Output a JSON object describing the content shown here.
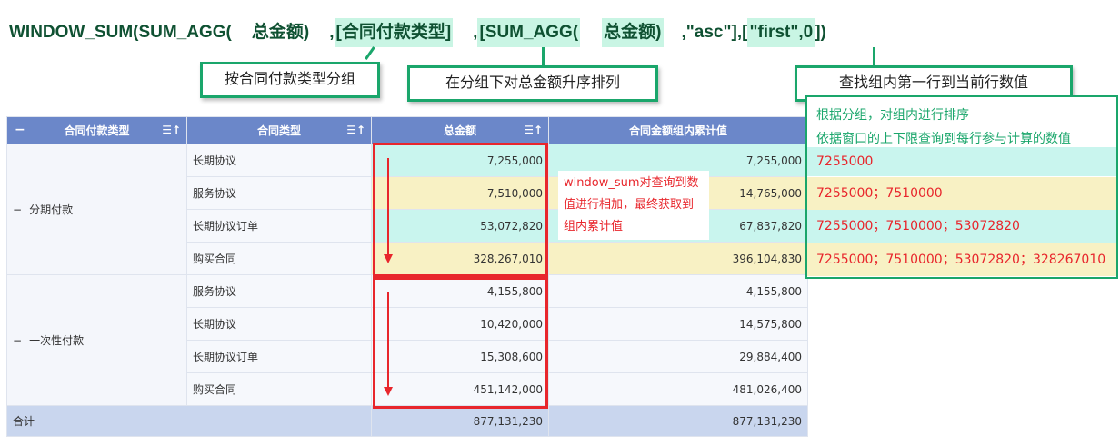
{
  "formula": {
    "p1": "WINDOW_SUM(SUM_AGG(",
    "p2": "总金额)",
    "p3": ",",
    "p4": "[合同付款类型]",
    "p5": ",",
    "p6": "[SUM_AGG(",
    "p7": "总金额)",
    "p8": ",\"asc\"],[",
    "p9": "\"first\",0",
    "p10": "])"
  },
  "labels": {
    "group_by": "按合同付款类型分组",
    "sort": "在分组下对总金额升序排列",
    "find": "查找组内第一行到当前行数值"
  },
  "table": {
    "headers": [
      "合同付款类型",
      "合同类型",
      "总金额",
      "合同金额组内累计值"
    ],
    "groups": [
      {
        "name": "分期付款",
        "rows": [
          {
            "type": "长期协议",
            "amount": "7,255,000",
            "cumulative": "7,255,000"
          },
          {
            "type": "服务协议",
            "amount": "7,510,000",
            "cumulative": "14,765,000"
          },
          {
            "type": "长期协议订单",
            "amount": "53,072,820",
            "cumulative": "67,837,820"
          },
          {
            "type": "购买合同",
            "amount": "328,267,010",
            "cumulative": "396,104,830"
          }
        ]
      },
      {
        "name": "一次性付款",
        "rows": [
          {
            "type": "服务协议",
            "amount": "4,155,800",
            "cumulative": "4,155,800"
          },
          {
            "type": "长期协议",
            "amount": "10,420,000",
            "cumulative": "14,575,800"
          },
          {
            "type": "长期协议订单",
            "amount": "15,308,600",
            "cumulative": "29,884,400"
          },
          {
            "type": "购买合同",
            "amount": "451,142,000",
            "cumulative": "481,026,400"
          }
        ]
      }
    ],
    "total": {
      "label": "合计",
      "amount": "877,131,230",
      "cumulative": "877,131,230"
    }
  },
  "note": "window_sum对查询到数值进行相加，最终获取到组内累计值",
  "side": {
    "line1": "根据分组，对组内进行排序",
    "line2": "依据窗口的上下限查询到每行参与计算的数值",
    "rows": [
      "7255000",
      "7255000；7510000",
      "7255000；7510000；53072820",
      "7255000；7510000；53072820；328267010"
    ]
  },
  "colors": {
    "accent_green": "#1aa66b",
    "red": "#e8262c",
    "header_blue": "#6b87c9",
    "cyan": "#c9f5ee",
    "yellow": "#f8f1c4"
  }
}
